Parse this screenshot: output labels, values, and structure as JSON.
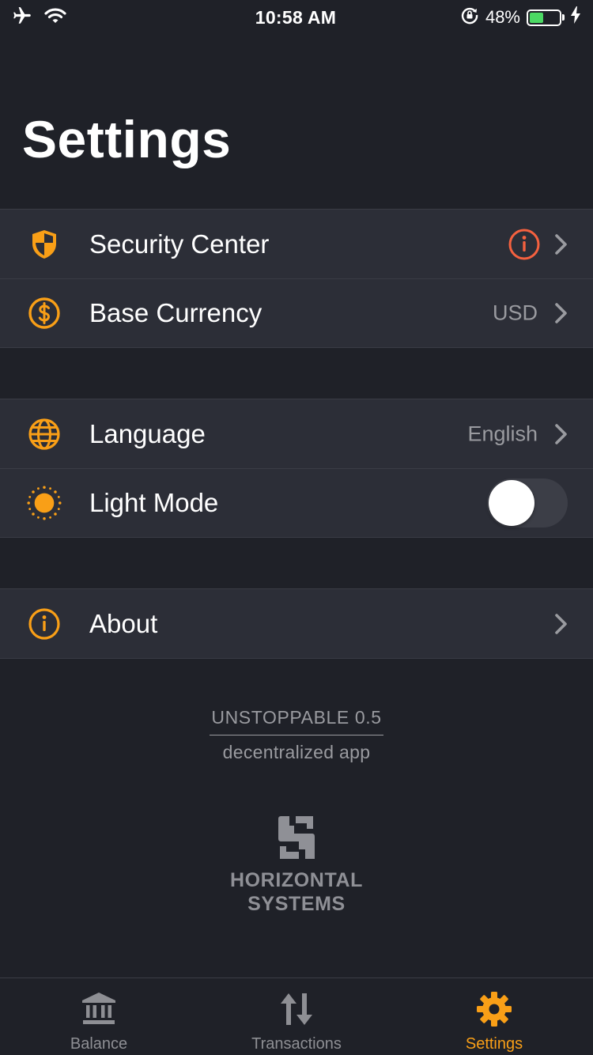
{
  "status_bar": {
    "time": "10:58 AM",
    "battery_percent": "48%",
    "battery_level": 0.48,
    "icons": [
      "airplane-icon",
      "wifi-icon",
      "rotation-lock-icon",
      "battery-icon",
      "charging-icon"
    ]
  },
  "page": {
    "title": "Settings"
  },
  "groups": [
    {
      "rows": [
        {
          "label": "Security Center",
          "icon": "shield-icon",
          "value": "",
          "has_alert": true
        },
        {
          "label": "Base Currency",
          "icon": "dollar-circle-icon",
          "value": "USD"
        }
      ]
    },
    {
      "rows": [
        {
          "label": "Language",
          "icon": "globe-icon",
          "value": "English"
        },
        {
          "label": "Light Mode",
          "icon": "sun-icon",
          "toggle_on": false
        }
      ]
    },
    {
      "rows": [
        {
          "label": "About",
          "icon": "info-icon",
          "value": ""
        }
      ]
    }
  ],
  "app_info": {
    "name": "UNSTOPPABLE 0.5",
    "subtitle": "decentralized app"
  },
  "company": {
    "line1": "HORIZONTAL",
    "line2": "SYSTEMS"
  },
  "tab_bar": {
    "tabs": [
      {
        "label": "Balance",
        "icon": "bank-icon",
        "active": false
      },
      {
        "label": "Transactions",
        "icon": "transfer-arrows-icon",
        "active": false
      },
      {
        "label": "Settings",
        "icon": "gear-icon",
        "active": true
      }
    ]
  },
  "colors": {
    "background": "#1f2128",
    "row_background": "#2c2e37",
    "accent": "#f99f17",
    "alert": "#f5613f",
    "secondary_text": "#9a9ba0"
  }
}
